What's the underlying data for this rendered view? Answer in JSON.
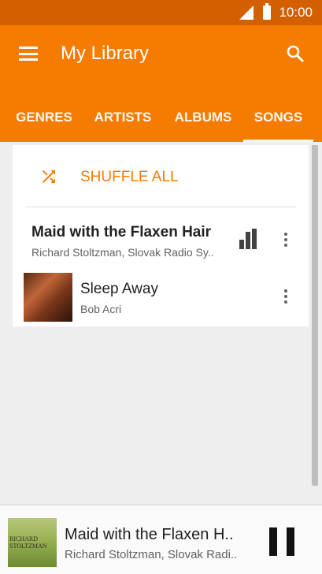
{
  "status_bar": {
    "time": "10:00"
  },
  "header": {
    "title": "My Library"
  },
  "tabs": [
    {
      "label": "GENRES"
    },
    {
      "label": "ARTISTS"
    },
    {
      "label": "ALBUMS"
    },
    {
      "label": "SONGS",
      "active": true
    }
  ],
  "shuffle": {
    "label": "SHUFFLE ALL"
  },
  "songs": [
    {
      "title": "Maid with the Flaxen Hair",
      "artist": "Richard Stoltzman, Slovak Radio Sy..",
      "playing": true
    },
    {
      "title": "Sleep Away",
      "artist": "Bob Acri",
      "playing": false
    }
  ],
  "now_playing": {
    "title": "Maid with the Flaxen H..",
    "artist": "Richard Stoltzman, Slovak Radi..",
    "art_text": "RICHARD STOLTZMAN"
  },
  "colors": {
    "accent": "#f57c00",
    "status_bar": "#d35f00"
  },
  "icons": [
    "menu-icon",
    "search-icon",
    "shuffle-icon",
    "equalizer-icon",
    "more-vert-icon",
    "pause-icon"
  ]
}
